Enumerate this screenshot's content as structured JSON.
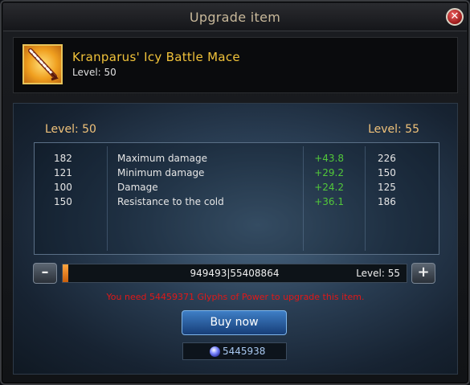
{
  "window": {
    "title": "Upgrade item",
    "close_icon": "close-icon"
  },
  "item": {
    "icon": "mace-icon",
    "name": "Kranparus' Icy Battle Mace",
    "level_text": "Level:  50"
  },
  "panel": {
    "level_left": "Level:  50",
    "level_right": "Level:  55",
    "stats": [
      {
        "old": "182",
        "name": "Maximum damage",
        "increase": "+43.8",
        "new": "226"
      },
      {
        "old": "121",
        "name": "Minimum damage",
        "increase": "+29.2",
        "new": "150"
      },
      {
        "old": "100",
        "name": "Damage",
        "increase": "+24.2",
        "new": "125"
      },
      {
        "old": "150",
        "name": "Resistance to the cold",
        "increase": "+36.1",
        "new": "186"
      }
    ],
    "slider": {
      "minus_label": "–",
      "plus_label": "+",
      "value_text": "949493|55408864",
      "progress": 0.017,
      "level_text": "Level:  55"
    },
    "warning": "You need 54459371 Glyphs of Power to upgrade this item.",
    "buy_label": "Buy now",
    "currency": {
      "icon": "gem-icon",
      "value": "5445938"
    }
  },
  "colors": {
    "title": "#c8b89a",
    "item_name": "#f0c23a",
    "level_label": "#f0c27a",
    "increase": "#52c83a",
    "warning": "#e01818",
    "buy_button": "#2a5ea0"
  }
}
